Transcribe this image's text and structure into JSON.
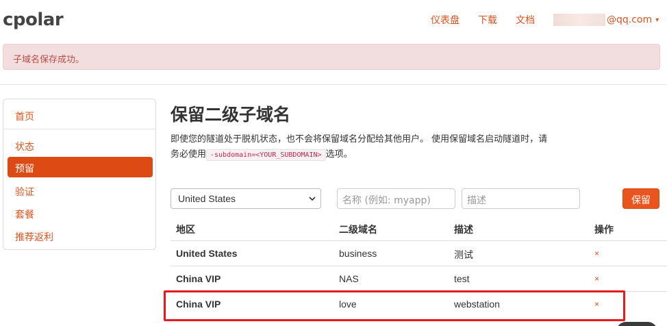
{
  "header": {
    "logo": "cpolar",
    "nav": [
      "仪表盘",
      "下载",
      "文档"
    ],
    "user_email": "@qq.com",
    "caret": "▾"
  },
  "alert": {
    "text": "子域名保存成功。"
  },
  "sidebar": {
    "items": [
      {
        "label": "首页",
        "active": false
      },
      {
        "label": "状态",
        "active": false
      },
      {
        "label": "预留",
        "active": true
      },
      {
        "label": "验证",
        "active": false
      },
      {
        "label": "套餐",
        "active": false
      },
      {
        "label": "推荐返利",
        "active": false
      }
    ]
  },
  "main": {
    "title": "保留二级子域名",
    "desc_part1": "即使您的隧道处于脱机状态，也不会将保留域名分配给其他用户。 使用保留域名启动隧道时，请务必使用",
    "code": "-subdomain=<YOUR_SUBDOMAIN>",
    "desc_part2": "选项。"
  },
  "form": {
    "region_value": "United States",
    "name_placeholder": "名称 (例如: myapp)",
    "desc_placeholder": "描述",
    "save_label": "保留"
  },
  "table": {
    "headers": [
      "地区",
      "二级域名",
      "描述",
      "操作"
    ],
    "rows": [
      {
        "region": "United States",
        "subdomain": "business",
        "description": "测试",
        "action": "×"
      },
      {
        "region": "China VIP",
        "subdomain": "NAS",
        "description": "test",
        "action": "×"
      },
      {
        "region": "China VIP",
        "subdomain": "love",
        "description": "webstation",
        "action": "×"
      }
    ]
  },
  "colors": {
    "accent": "#d9531e",
    "active_bg": "#de4a14",
    "alert_bg": "#f2dede",
    "highlight_border": "#e8191d"
  }
}
